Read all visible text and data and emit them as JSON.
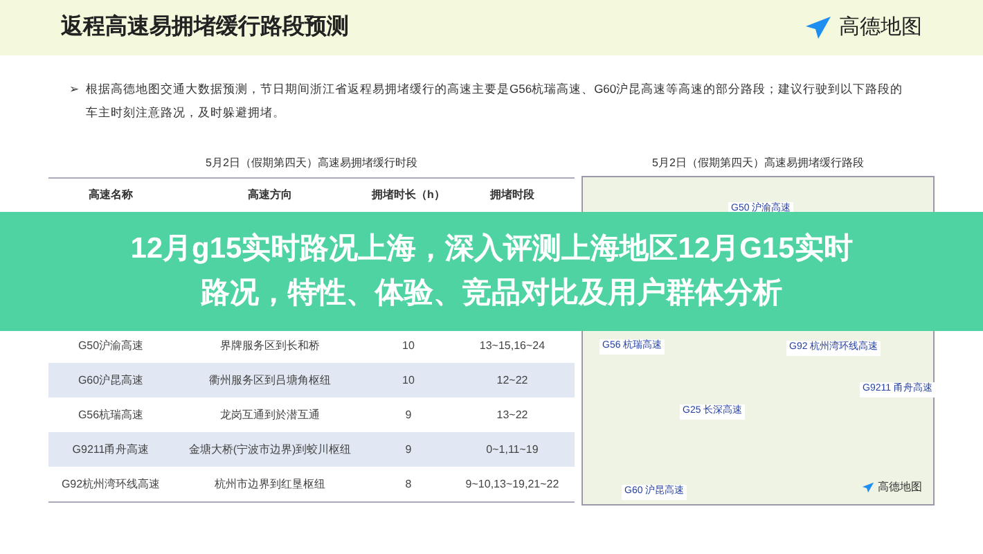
{
  "header": {
    "title": "返程高速易拥堵缓行路段预测",
    "logo": "高德地图"
  },
  "note": {
    "marker": "➢",
    "text": "根据高德地图交通大数据预测，节日期间浙江省返程易拥堵缓行的高速主要是G56杭瑞高速、G60沪昆高速等高速的部分路段；建议行驶到以下路段的车主时刻注意路况，及时躲避拥堵。"
  },
  "table": {
    "caption": "5月2日（假期第四天）高速易拥堵缓行时段",
    "columns": [
      "高速名称",
      "高速方向",
      "拥堵时长（h）",
      "拥堵时段"
    ],
    "rows": [
      {
        "cells": [
          "G50沪渝高速",
          "界牌服务区到长和桥",
          "10",
          "13~15,16~24"
        ]
      },
      {
        "cells": [
          "G60沪昆高速",
          "衢州服务区到吕塘角枢纽",
          "10",
          "12~22"
        ]
      },
      {
        "cells": [
          "G56杭瑞高速",
          "龙岗互通到於潜互通",
          "9",
          "13~22"
        ]
      },
      {
        "cells": [
          "G9211甬舟高速",
          "金塘大桥(宁波市边界)到蛟川枢纽",
          "9",
          "0~1,11~19"
        ]
      },
      {
        "cells": [
          "G92杭州湾环线高速",
          "杭州市边界到红垦枢纽",
          "8",
          "9~10,13~19,21~22"
        ]
      }
    ]
  },
  "map": {
    "caption": "5月2日（假期第四天）高速易拥堵缓行路段",
    "labels": [
      "G50 沪渝高速",
      "G56 杭瑞高速",
      "G92 杭州湾环线高速",
      "G9211 甬舟高速",
      "G25 长深高速",
      "G60 沪昆高速"
    ],
    "logo": "高德地图"
  },
  "banner": {
    "lines": [
      "12月g15实时路况上海，深入评测上海地区12月G15实时",
      "路况，特性、体验、竞品对比及用户群体分析"
    ]
  }
}
